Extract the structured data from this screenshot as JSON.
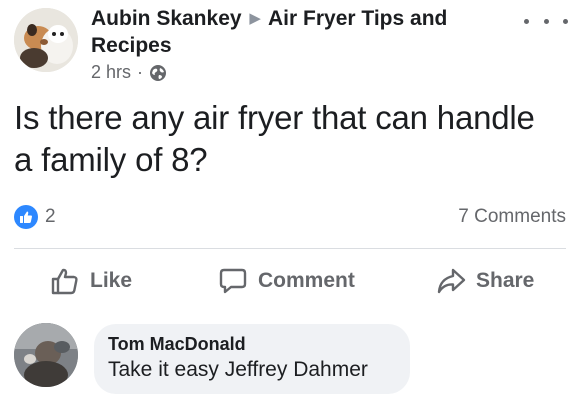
{
  "post": {
    "author": "Aubin Skankey",
    "group": "Air Fryer Tips and Recipes",
    "time": "2 hrs",
    "separator": "·",
    "privacy_icon": "globe-icon",
    "more_icon": "more-options-icon",
    "text": "Is there any air fryer that can handle a family of 8?"
  },
  "stats": {
    "reaction_icon": "like-reaction-icon",
    "reaction_count": "2",
    "comments": "7 Comments"
  },
  "actions": {
    "like": "Like",
    "comment": "Comment",
    "share": "Share"
  },
  "comment": {
    "author": "Tom MacDonald",
    "text": "Take it easy Jeffrey Dahmer"
  },
  "colors": {
    "like_blue": "#2d88ff",
    "secondary_text": "#65676b",
    "bubble_bg": "#f0f2f5"
  }
}
